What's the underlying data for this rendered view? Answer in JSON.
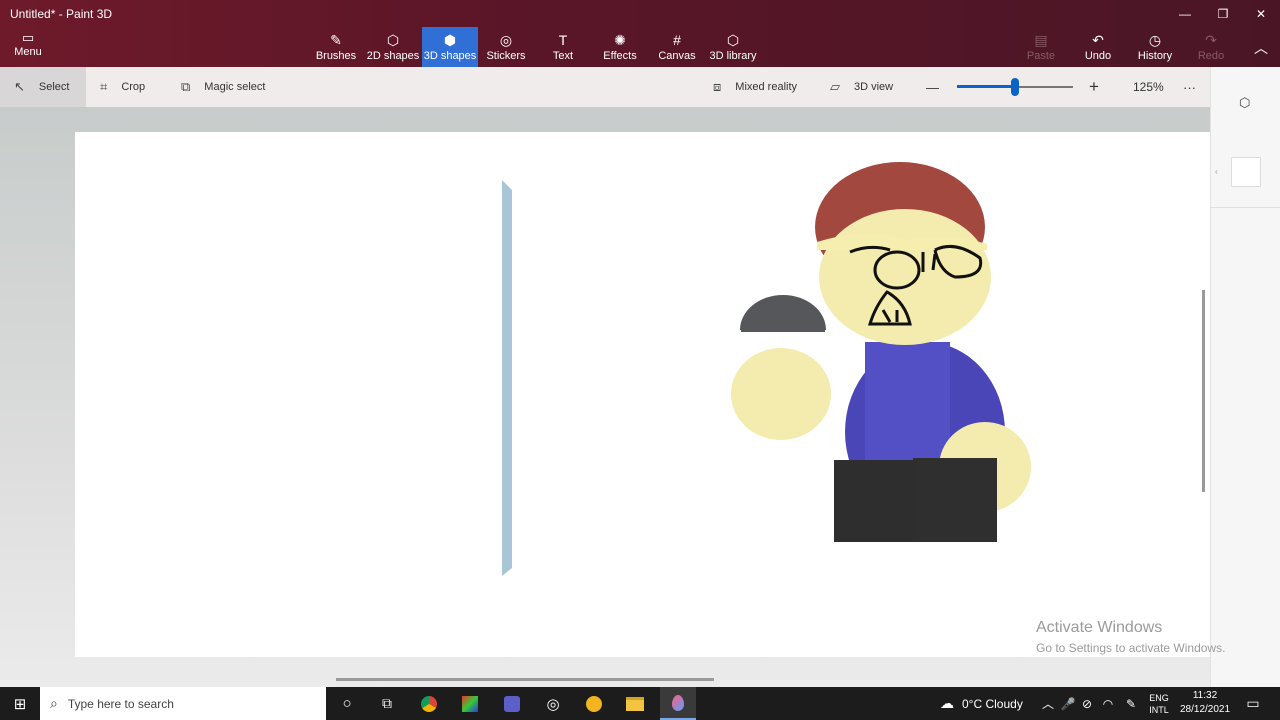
{
  "window": {
    "title": "Untitled* - Paint 3D",
    "controls": [
      "—",
      "❐",
      "✕"
    ]
  },
  "ribbon": {
    "menu_label": "Menu",
    "tools": [
      {
        "label": "Brushes",
        "icon": "✎"
      },
      {
        "label": "2D shapes",
        "icon": "⬡"
      },
      {
        "label": "3D shapes",
        "icon": "⬢"
      },
      {
        "label": "Stickers",
        "icon": "◎"
      },
      {
        "label": "Text",
        "icon": "T"
      },
      {
        "label": "Effects",
        "icon": "✺"
      },
      {
        "label": "Canvas",
        "icon": "#"
      },
      {
        "label": "3D library",
        "icon": "⬡"
      }
    ],
    "active_tool": "3D shapes",
    "paste_label": "Paste",
    "undo_label": "Undo",
    "history_label": "History",
    "redo_label": "Redo"
  },
  "toolbar": {
    "select_label": "Select",
    "crop_label": "Crop",
    "magic_select_label": "Magic select",
    "mixed_reality_label": "Mixed reality",
    "view3d_label": "3D view",
    "zoom_minus": "—",
    "zoom_plus": "+",
    "zoom_level": "125%",
    "zoom_fraction": 0.5,
    "more": "···"
  },
  "watermark": {
    "title": "Activate Windows",
    "subtitle": "Go to Settings to activate Windows."
  },
  "taskbar": {
    "search_placeholder": "Type here to search",
    "weather": "0°C  Cloudy",
    "lang1": "ENG",
    "lang2": "INTL",
    "time": "11:32",
    "date": "28/12/2021"
  },
  "colors": {
    "accent": "#2f6fd6",
    "titlebar": "#5a1628",
    "character_body": "#4a46b8",
    "character_skin": "#f3ecae",
    "character_hair": "#a3483e"
  }
}
